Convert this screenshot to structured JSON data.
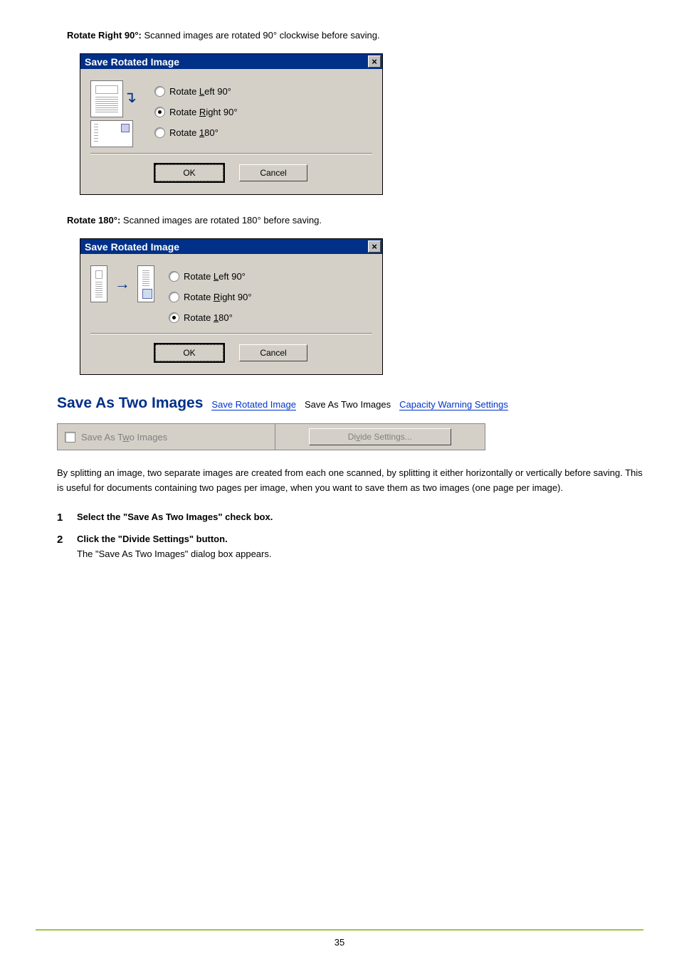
{
  "intro90": {
    "label": "Rotate Right 90°:",
    "text": " Scanned images are rotated 90° clockwise before saving."
  },
  "intro180": {
    "label": "Rotate 180°:",
    "text": " Scanned images are rotated 180° before saving."
  },
  "dialog": {
    "title": "Save Rotated Image",
    "close": "×",
    "radios": {
      "left_pre": "Rotate ",
      "left_u": "L",
      "left_post": "eft 90°",
      "right_pre": "Rotate ",
      "right_u": "R",
      "right_post": "ight 90°",
      "r180_pre": "Rotate ",
      "r180_u": "1",
      "r180_post": "80°"
    },
    "ok": "OK",
    "cancel": "Cancel"
  },
  "section": {
    "heading": "Save As Two Images",
    "link_prev": "Save Rotated Image",
    "current": "Save As Two Images",
    "link_next": "Capacity Warning Settings"
  },
  "strip": {
    "check_pre": "Save As T",
    "check_u": "w",
    "check_post": "o Images",
    "button_pre": "Di",
    "button_u": "v",
    "button_post": "ide Settings..."
  },
  "paragraph": "By splitting an image, two separate images are created from each one scanned, by splitting it either horizontally or vertically before saving. This is useful for documents containing two pages per image, when you want to save them as two images (one page per image).",
  "steps": {
    "n1": "1",
    "s1": "Select the \"Save As Two Images\" check box.",
    "n2": "2",
    "s2": "Click the \"Divide Settings\" button.",
    "s2sub": "The \"Save As Two Images\" dialog box appears."
  },
  "page_number": "35"
}
